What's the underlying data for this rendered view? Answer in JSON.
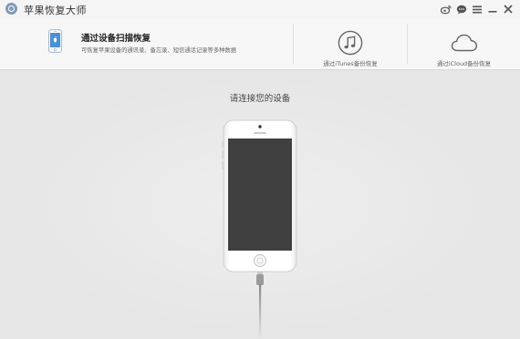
{
  "app": {
    "title": "苹果恢复大师",
    "logo_icon": "app-logo-icon"
  },
  "titlebar_icons": [
    {
      "name": "weibo-icon"
    },
    {
      "name": "feedback-icon"
    },
    {
      "name": "menu-icon"
    },
    {
      "name": "minimize-icon"
    },
    {
      "name": "close-icon"
    }
  ],
  "options": {
    "device": {
      "title": "通过设备扫描恢复",
      "description": "可恢复苹果设备的通讯录、备忘录、短信通话记录等多种数据",
      "icon": "iphone-icon"
    },
    "itunes": {
      "label": "通过iTunes备份恢复",
      "icon": "music-note-icon"
    },
    "icloud": {
      "label": "通过iCloud备份恢复",
      "icon": "cloud-icon"
    }
  },
  "main": {
    "prompt": "请连接您的设备"
  },
  "colors": {
    "accent": "#4a90d9",
    "background": "#e7e7e7",
    "header_background": "#f7f7f7"
  }
}
